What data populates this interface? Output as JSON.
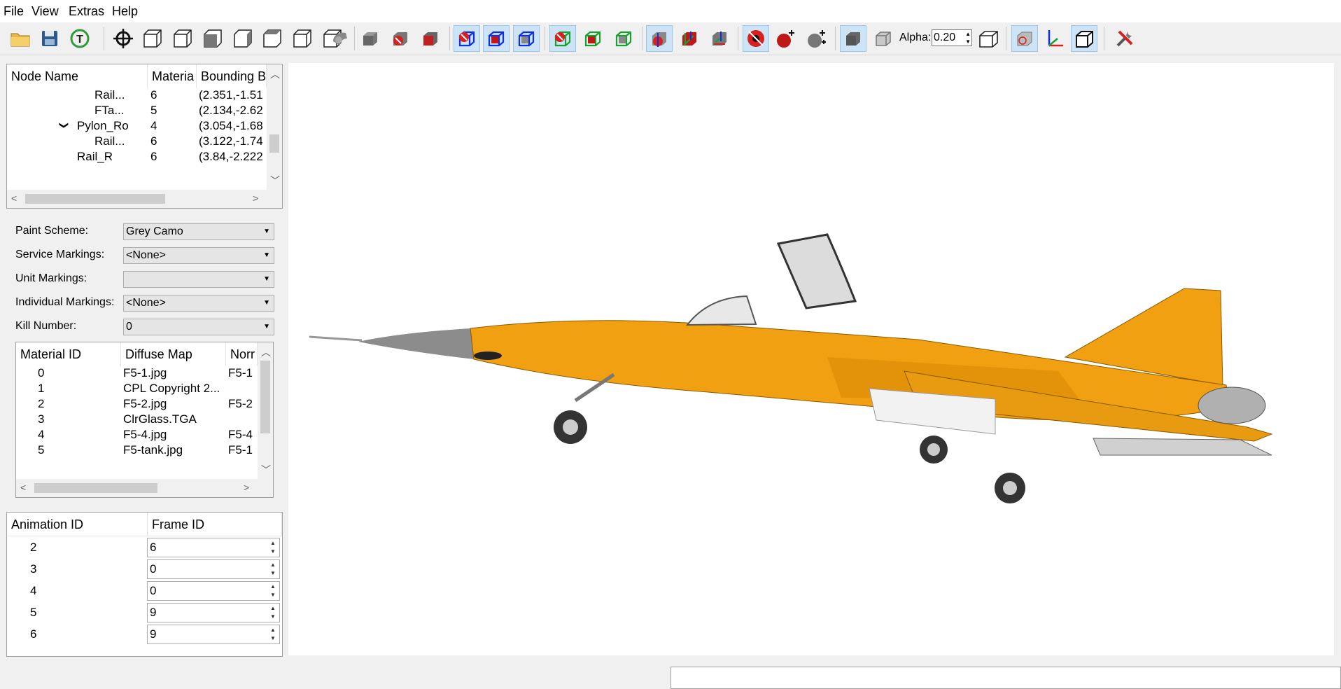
{
  "menu": [
    "File",
    "View",
    "Extras",
    "Help"
  ],
  "toolbar": {
    "alpha_label": "Alpha:",
    "alpha_value": "0.20",
    "icons": [
      "open-folder-icon",
      "save-icon",
      "reset-icon",
      "zoom-fit-icon",
      "view-front-icon",
      "view-back-icon",
      "view-left-icon",
      "view-right-icon",
      "view-top-icon",
      "view-bottom-icon",
      "view-iso-icon",
      "shaded-icon",
      "solid-cube-icon",
      "textured-cube-icon",
      "red-cube-icon",
      "no-bbox-blue-icon",
      "red-bbox-blue-icon",
      "bbox-blue-icon",
      "no-bbox-green-icon",
      "red-bbox-green-icon",
      "bbox-green-icon",
      "axis-cube-icon",
      "red-axis-cube-icon",
      "axis-cube-2-icon",
      "no-light-icon",
      "light-red-icon",
      "light-gray-icon",
      "solid-box-icon",
      "transparent-box-icon",
      "wireframe-box-icon",
      "grid-box-icon",
      "axes-icon",
      "box-outline-icon",
      "settings-icon"
    ]
  },
  "node_tree": {
    "headers": [
      "Node Name",
      "Materia",
      "Bounding B"
    ],
    "rows": [
      {
        "name": "Rail...",
        "material": "6",
        "bbox": "(2.351,-1.51",
        "indent": 3,
        "expander": false
      },
      {
        "name": "FTa...",
        "material": "5",
        "bbox": "(2.134,-2.62",
        "indent": 3,
        "expander": false
      },
      {
        "name": "Pylon_Ro",
        "material": "4",
        "bbox": "(3.054,-1.68",
        "indent": 2,
        "expander": true
      },
      {
        "name": "Rail...",
        "material": "6",
        "bbox": "(3.122,-1.74",
        "indent": 3,
        "expander": false
      },
      {
        "name": "Rail_R",
        "material": "6",
        "bbox": "(3.84,-2.222",
        "indent": 2,
        "expander": false
      }
    ]
  },
  "markings": {
    "paint_scheme": {
      "label": "Paint Scheme:",
      "value": "Grey Camo"
    },
    "service_markings": {
      "label": "Service Markings:",
      "value": "<None>"
    },
    "unit_markings": {
      "label": "Unit Markings:",
      "value": ""
    },
    "individual_markings": {
      "label": "Individual Markings:",
      "value": "<None>"
    },
    "kill_number": {
      "label": "Kill Number:",
      "value": "0"
    }
  },
  "materials": {
    "headers": [
      "Material ID",
      "Diffuse Map",
      "Norr"
    ],
    "rows": [
      {
        "id": "0",
        "diffuse": "F5-1.jpg",
        "normal": "F5-1"
      },
      {
        "id": "1",
        "diffuse": "CPL Copyright 2...",
        "normal": ""
      },
      {
        "id": "2",
        "diffuse": "F5-2.jpg",
        "normal": "F5-2"
      },
      {
        "id": "3",
        "diffuse": "ClrGlass.TGA",
        "normal": ""
      },
      {
        "id": "4",
        "diffuse": "F5-4.jpg",
        "normal": "F5-4"
      },
      {
        "id": "5",
        "diffuse": "F5-tank.jpg",
        "normal": "F5-1"
      }
    ]
  },
  "animations": {
    "headers": [
      "Animation ID",
      "Frame ID"
    ],
    "rows": [
      {
        "id": "2",
        "frame": "6"
      },
      {
        "id": "3",
        "frame": "0"
      },
      {
        "id": "4",
        "frame": "0"
      },
      {
        "id": "5",
        "frame": "9"
      },
      {
        "id": "6",
        "frame": "9"
      }
    ]
  },
  "colors": {
    "airframe": "#f0a010",
    "accent": "#0078d7"
  }
}
